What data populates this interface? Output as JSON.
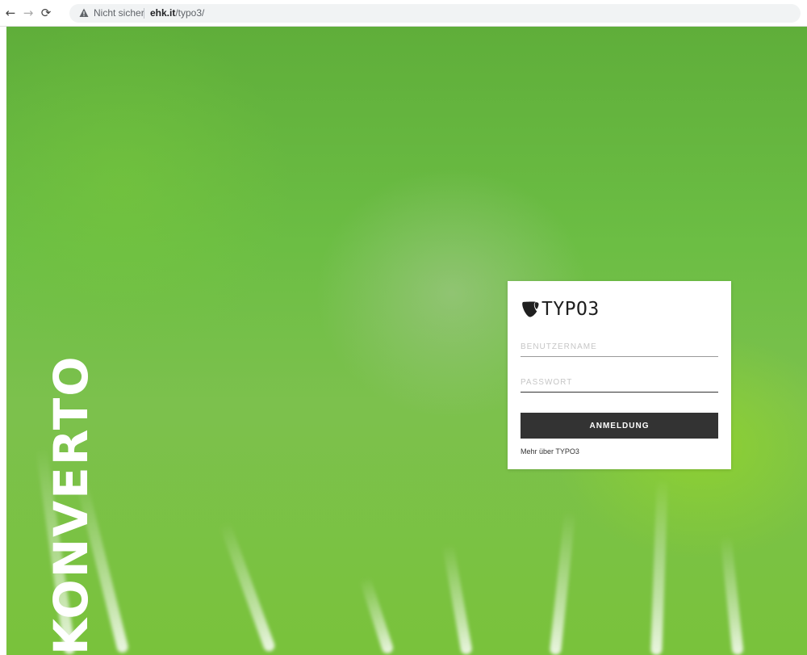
{
  "browser": {
    "back_icon": "arrow-left-icon",
    "forward_icon": "arrow-right-icon",
    "reload_icon": "reload-icon",
    "security_icon": "warning-triangle-icon",
    "security_label": "Nicht sicher",
    "url_host": "ehk.it",
    "url_path": "/typo3/"
  },
  "brand": {
    "name": "KONVERTO"
  },
  "login": {
    "logo_text": "TYPO3",
    "username_placeholder": "BENUTZERNAME",
    "password_placeholder": "PASSWORT",
    "submit_label": "ANMELDUNG",
    "more_link": "Mehr über TYPO3"
  },
  "colors": {
    "background": "#6cbe44",
    "button": "#333333",
    "card": "#ffffff"
  }
}
